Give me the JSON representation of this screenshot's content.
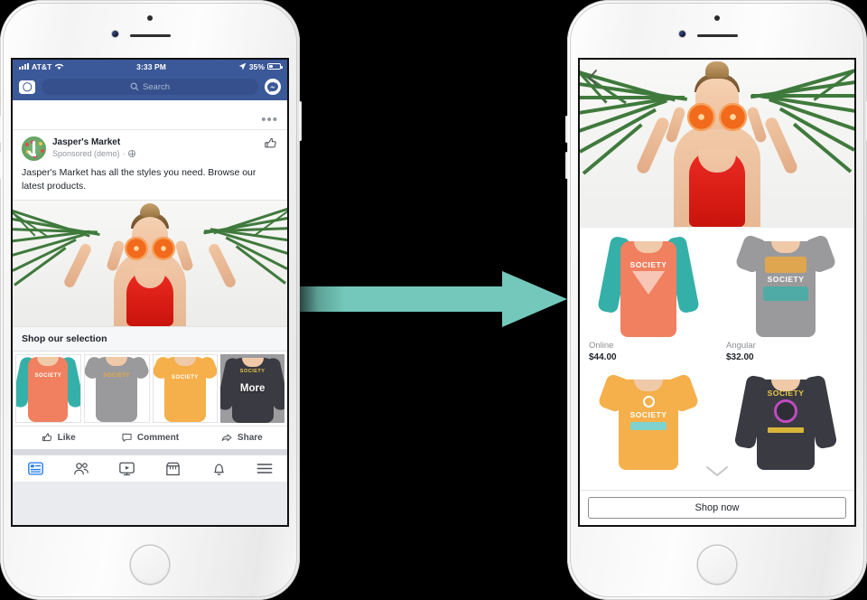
{
  "meta": {
    "accent_blue": "#3b5998",
    "arrow_color": "#74c8bb",
    "link_blue": "#1877f2"
  },
  "left_phone": {
    "status_bar": {
      "carrier": "AT&T",
      "time": "3:33 PM",
      "battery": "35%",
      "signal_icon": "signal-bars-icon",
      "wifi_icon": "wifi-icon",
      "location_icon": "location-arrow-icon",
      "battery_icon": "battery-icon"
    },
    "nav_bar": {
      "camera_icon": "camera-icon",
      "search_placeholder": "Search",
      "search_icon": "search-icon",
      "messenger_icon": "messenger-icon"
    },
    "post": {
      "menu_icon": "ellipsis-icon",
      "page_name": "Jasper's Market",
      "subtitle": "Sponsored (demo)",
      "separator": "·",
      "audience_icon": "globe-icon",
      "like_page_icon": "thumbs-up-outline-icon",
      "body": "Jasper's Market has all the styles you need. Browse our latest products.",
      "hero_alt": "woman in red swimsuit holding grapefruit halves over eyes with palm leaves"
    },
    "carousel": {
      "title": "Shop our selection",
      "more_label": "More",
      "tiles": [
        {
          "name": "coral-raglan-tee",
          "shirt_color": "#f0805f",
          "sleeve_color": "#35b0a8"
        },
        {
          "name": "grey-graphic-tee",
          "shirt_color": "#9a9a9c",
          "sleeve_color": "#9a9a9c"
        },
        {
          "name": "orange-graphic-tee",
          "shirt_color": "#f5b04b",
          "sleeve_color": "#f5b04b"
        },
        {
          "name": "black-society-sweatshirt",
          "shirt_color": "#3a3a42",
          "sleeve_color": "#3a3a42"
        }
      ]
    },
    "actions": [
      {
        "label": "Like",
        "icon": "thumbs-up-outline-icon"
      },
      {
        "label": "Comment",
        "icon": "comment-bubble-icon"
      },
      {
        "label": "Share",
        "icon": "share-arrow-icon"
      }
    ],
    "tab_bar": [
      {
        "name": "news-feed",
        "icon": "news-feed-icon",
        "active": true
      },
      {
        "name": "friends",
        "icon": "friends-icon",
        "active": false
      },
      {
        "name": "watch",
        "icon": "watch-video-icon",
        "active": false
      },
      {
        "name": "marketplace",
        "icon": "marketplace-store-icon",
        "active": false
      },
      {
        "name": "notifications",
        "icon": "bell-icon",
        "active": false
      },
      {
        "name": "menu",
        "icon": "hamburger-menu-icon",
        "active": false
      }
    ]
  },
  "right_phone": {
    "back_icon": "chevron-left-icon",
    "hero_alt": "woman in red swimsuit holding grapefruit halves over eyes with palm leaves",
    "scroll_hint_icon": "chevron-down-icon",
    "products": [
      {
        "name": "Online",
        "price": "$44.00",
        "shirt_color": "#f0805f",
        "sleeve_color": "#35b0a8",
        "graphic_color": "#ffffff",
        "graphic_text": "SOCIETY"
      },
      {
        "name": "Angular",
        "price": "$32.00",
        "shirt_color": "#9a9a9c",
        "sleeve_color": "#9a9a9c",
        "graphic_color": "#ffffff",
        "graphic_text": "SOCIETY"
      },
      {
        "name": "",
        "price": "",
        "shirt_color": "#f5b04b",
        "sleeve_color": "#f5b04b",
        "graphic_color": "#ffffff",
        "graphic_text": "SOCIETY"
      },
      {
        "name": "",
        "price": "",
        "shirt_color": "#3a3a42",
        "sleeve_color": "#3a3a42",
        "graphic_color": "#e8c84a",
        "graphic_text": "SOCIETY"
      }
    ],
    "cta_label": "Shop now"
  },
  "arrow": {
    "name": "transition-arrow",
    "direction": "right"
  }
}
